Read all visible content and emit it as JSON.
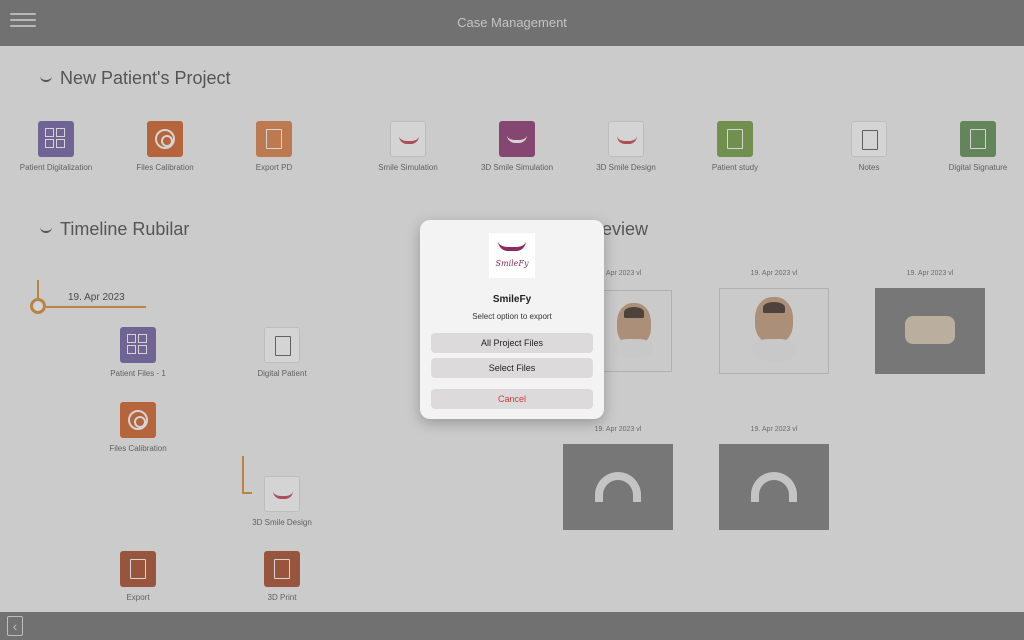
{
  "header": {
    "title": "Case Management",
    "menu_icon": "menu-icon"
  },
  "sections": {
    "project_title": "New Patient's Project",
    "timeline_title": "Timeline Rubilar",
    "preview_title": "Preview"
  },
  "tools": [
    {
      "label": "Patient Digitalization",
      "icon": "grid-icon"
    },
    {
      "label": "Files Calibration",
      "icon": "target-icon"
    },
    {
      "label": "Export PD",
      "icon": "export-icon"
    },
    {
      "label": "Smile Simulation",
      "icon": "smile-icon"
    },
    {
      "label": "3D Smile Simulation",
      "icon": "smile-3d-icon"
    },
    {
      "label": "3D Smile Design",
      "icon": "smile-design-icon"
    },
    {
      "label": "Patient study",
      "icon": "study-icon"
    },
    {
      "label": "Notes",
      "icon": "notes-icon"
    },
    {
      "label": "Digital Signature",
      "icon": "signature-icon"
    }
  ],
  "timeline": {
    "date": "19. Apr 2023",
    "items": [
      {
        "label": "Patient Files - 1"
      },
      {
        "label": "Digital Patient"
      },
      {
        "label": "Files Calibration"
      },
      {
        "label": "3D Smile Design"
      },
      {
        "label": "Export"
      },
      {
        "label": "3D Print"
      }
    ]
  },
  "preview": {
    "thumbs": [
      {
        "label": "19. Apr 2023 vl"
      },
      {
        "label": "19. Apr 2023 vl"
      },
      {
        "label": "19. Apr 2023 vl"
      },
      {
        "label": "19. Apr 2023 vl"
      },
      {
        "label": "19. Apr 2023 vl"
      }
    ]
  },
  "dialog": {
    "logo_text": "SmileFy",
    "title": "SmileFy",
    "message": "Select option to export",
    "option_all": "All Project Files",
    "option_select": "Select Files",
    "cancel": "Cancel"
  },
  "footer": {
    "back_icon": "chevron-left-icon"
  }
}
